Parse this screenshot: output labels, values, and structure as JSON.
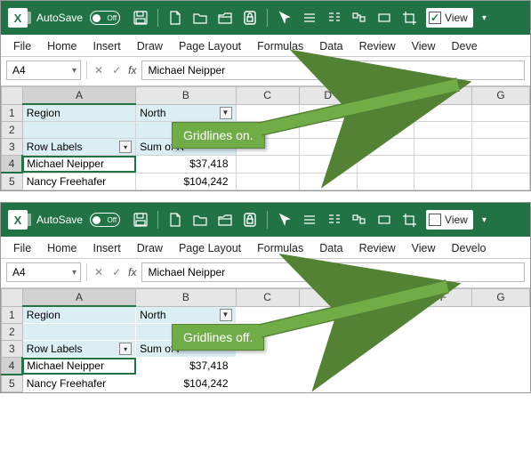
{
  "autosave": {
    "label": "AutoSave",
    "state": "Off"
  },
  "view_checkbox": {
    "label": "View"
  },
  "tabs": [
    "File",
    "Home",
    "Insert",
    "Draw",
    "Page Layout",
    "Formulas",
    "Data",
    "Review",
    "View",
    "Deve"
  ],
  "tabs2": [
    "File",
    "Home",
    "Insert",
    "Draw",
    "Page Layout",
    "Formulas",
    "Data",
    "Review",
    "View",
    "Develo"
  ],
  "namebox": "A4",
  "formula_value": "Michael Neipper",
  "columns": [
    "A",
    "B",
    "C",
    "D",
    "E",
    "F",
    "G"
  ],
  "rows": {
    "r1": {
      "num": "1",
      "a": "Region",
      "b": "North"
    },
    "r2": {
      "num": "2"
    },
    "r3": {
      "num": "3",
      "a": "Row Labels",
      "b": "Sum of R"
    },
    "r3b": {
      "b": "Sum of F"
    },
    "r4": {
      "num": "4",
      "a": "Michael Neipper",
      "b": "$37,418"
    },
    "r5": {
      "num": "5",
      "a": "Nancy Freehafer",
      "b": "$104,242"
    }
  },
  "callouts": {
    "on": "Gridlines on.",
    "off": "Gridlines off."
  },
  "filter_glyph": "▾",
  "funnel_glyph": "▼"
}
